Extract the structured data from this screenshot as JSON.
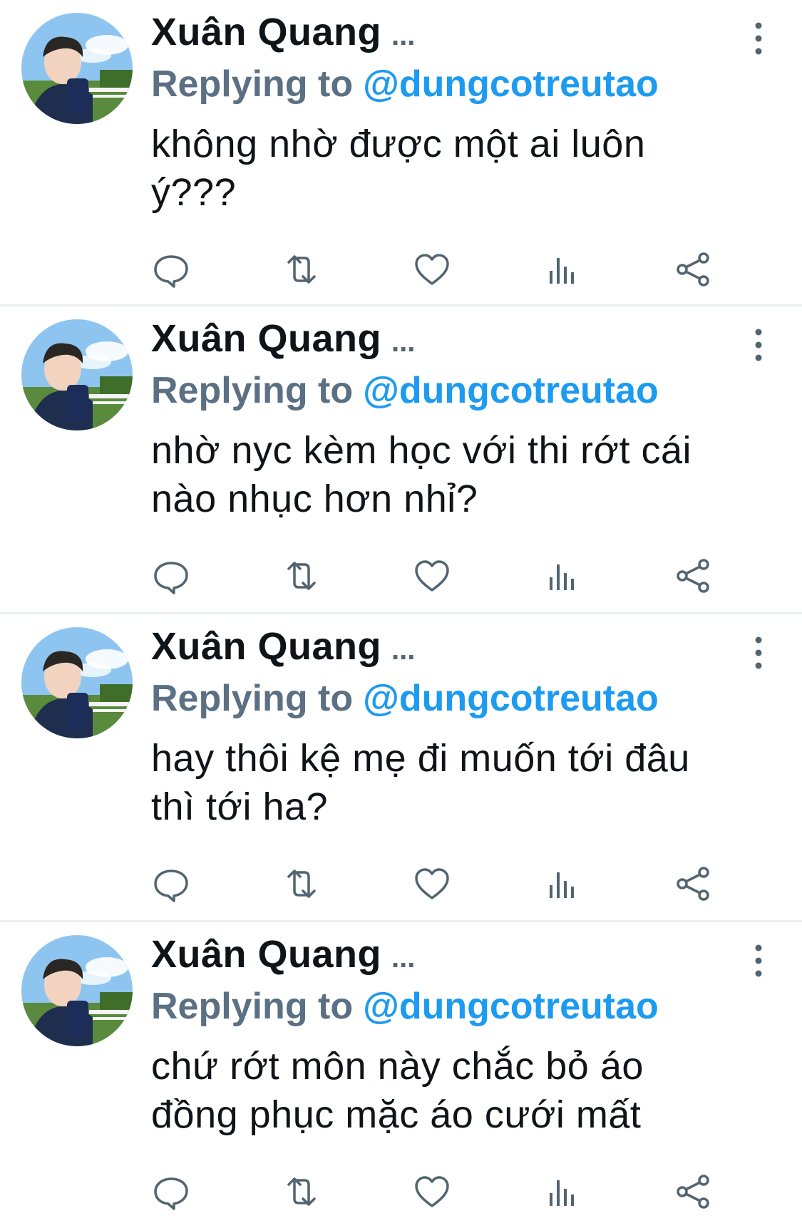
{
  "tweets": [
    {
      "author": "Xuân Quang",
      "ellipsis": "...",
      "replying_label": "Replying to",
      "handle": "@dungcotreutao",
      "text_lines": [
        "không nhờ được một ai luôn",
        "ý???"
      ]
    },
    {
      "author": "Xuân Quang",
      "ellipsis": "...",
      "replying_label": "Replying to",
      "handle": "@dungcotreutao",
      "text_lines": [
        "nhờ nyc kèm học với thi rớt cái",
        "nào nhục hơn nhỉ?"
      ]
    },
    {
      "author": "Xuân Quang",
      "ellipsis": "...",
      "replying_label": "Replying to",
      "handle": "@dungcotreutao",
      "text_lines": [
        "hay thôi kệ mẹ đi muốn tới đâu",
        "thì tới ha?"
      ]
    },
    {
      "author": "Xuân Quang",
      "ellipsis": "...",
      "replying_label": "Replying to",
      "handle": "@dungcotreutao",
      "text_lines": [
        "chứ rớt môn này chắc bỏ áo",
        "đồng phục mặc áo cưới mất"
      ]
    }
  ],
  "icons": {
    "reply": "reply-icon",
    "retweet": "retweet-icon",
    "like": "heart-icon",
    "analytics": "analytics-icon",
    "share": "share-icon",
    "more": "more-vertical-icon"
  },
  "colors": {
    "text": "#0f1419",
    "secondary": "#5b7083",
    "link": "#1d9bf0",
    "icon": "#536471",
    "divider": "#ebeef0"
  }
}
